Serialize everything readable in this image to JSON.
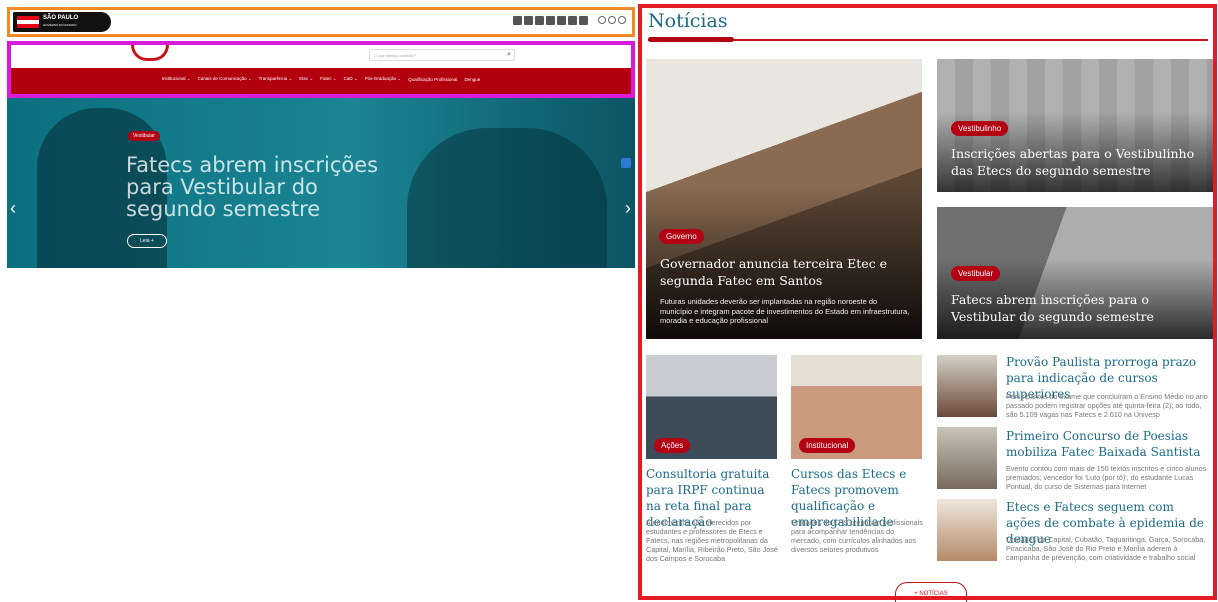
{
  "gov_bar": {
    "logo_text": "SÃO PAULO",
    "logo_sub": "GOVERNO DO ESTADO"
  },
  "site": {
    "search_placeholder": "O que deseja localizar?",
    "nav": [
      "Institucional ⌄",
      "Canais de Comunicação ⌄",
      "Transparência ⌄",
      "Etec ⌄",
      "Fatec ⌄",
      "CaD ⌄",
      "Pós-Graduação ⌄",
      "Qualificação Profissional",
      "Dengue"
    ],
    "hero": {
      "category": "Vestibular",
      "title": "Fatecs abrem inscrições para Vestibular do segundo semestre",
      "more": "Leia +"
    }
  },
  "news": {
    "heading": "Notícias",
    "featured": [
      {
        "category": "Governo",
        "title": "Governador anuncia terceira Etec e segunda Fatec em Santos",
        "desc": "Futuras unidades deverão ser implantadas na região noroeste do município e integram pacote de investimentos do Estado em infraestrutura, moradia e educação profissional"
      },
      {
        "category": "Vestibulinho",
        "title": "Inscrições abertas para o Vestibulinho das Etecs do segundo semestre"
      },
      {
        "category": "Vestibular",
        "title": "Fatecs abrem inscrições para o Vestibular do segundo semestre"
      }
    ],
    "grid": [
      {
        "category": "Ações",
        "title": "Consultoria gratuita para IRPF continua na reta final para declaração",
        "desc": "Atendimentos são oferecidos por estudantes e professores de Etecs e Fatecs, nas regiões metropolitanas da Capital, Marília, Ribeirão Preto, São José dos Campos e Sorocaba"
      },
      {
        "category": "Institucional",
        "title": "Cursos das Etecs e Fatecs promovem qualificação e empregabilidade",
        "desc": "Unidades do CPS preparam profissionais para acompanhar tendências do mercado, com currículos alinhados aos diversos setores produtivos"
      }
    ],
    "list": [
      {
        "title": "Provão Paulista prorroga prazo para indicação de cursos superiores",
        "desc": "Participantes do exame que concluíram o Ensino Médio no ano passado podem registrar opções até quinta-feira (2); ao todo, são 5.109 vagas nas Fatecs e 2.610 na Univesp"
      },
      {
        "title": "Primeiro Concurso de Poesias mobiliza Fatec Baixada Santista",
        "desc": "Evento contou com mais de 150 textos inscritos e cinco alunos premiados; vencedor foi 'Luto (por tô)', do estudante Lucas Pontual, do curso de Sistemas para Internet"
      },
      {
        "title": "Etecs e Fatecs seguem com ações de combate à epidemia de dengue",
        "desc": "Unidades da Capital, Cubatão, Taquaritinga, Garça, Sorocaba, Piracicaba, São José do Rio Preto e Marília aderem à campanha de prevenção, com criatividade e trabalho social"
      }
    ],
    "more_button": "+ NOTÍCIAS"
  },
  "colors": {
    "accent_red": "#b30012",
    "title_blue": "#1a6a8a",
    "frame_red": "#e31b23",
    "frame_orange": "#f08a24",
    "frame_magenta": "#d81bd8"
  }
}
